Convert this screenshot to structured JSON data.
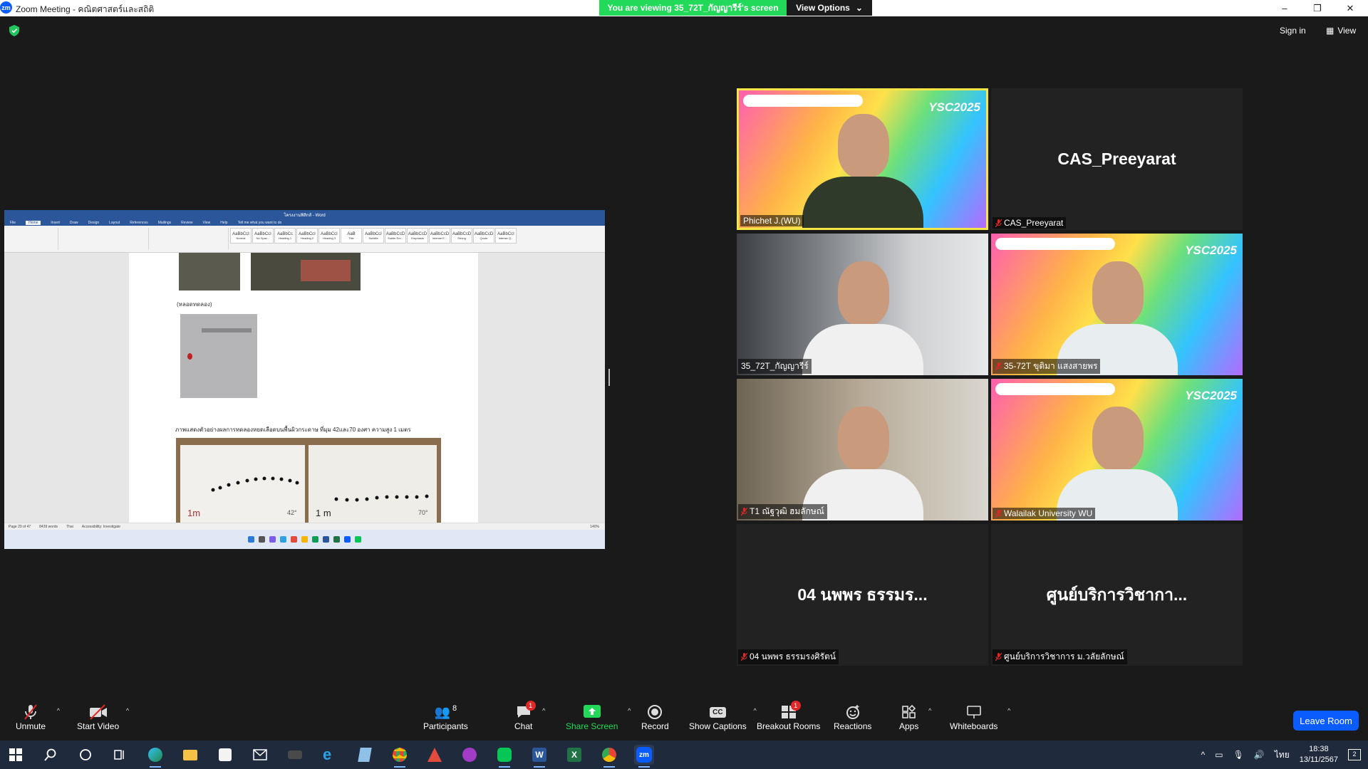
{
  "window": {
    "title": "Zoom Meeting - คณิตศาสตร์และสถิติ",
    "minimize": "–",
    "maximize": "❐",
    "close": "✕"
  },
  "banner": {
    "text": "You are viewing 35_72T_กัญญารีร์'s screen",
    "view_options": "View Options"
  },
  "topbar": {
    "sign_in": "Sign in",
    "view": "View"
  },
  "shared_screen": {
    "window_title": "โครงงานฟิสิกส์ - Word",
    "tabs": [
      "File",
      "Home",
      "Insert",
      "Draw",
      "Design",
      "Layout",
      "References",
      "Mailings",
      "Review",
      "View",
      "Help",
      "Tell me what you want to do"
    ],
    "active_tab": "Home",
    "styles": [
      "AaBbCcI",
      "AaBbCcI",
      "AaBbCc",
      "AaBbCcI",
      "AaBbCcI",
      "AaB",
      "AaBbCcI",
      "AaBbCcD",
      "AaBbCcD",
      "AaBbCcD",
      "AaBbCcD",
      "AaBbCcD",
      "AaBbCcI"
    ],
    "style_names": [
      "Normal",
      "No Spac...",
      "Heading 1",
      "Heading 2",
      "Heading 3",
      "Title",
      "Subtitle",
      "Subtle Em...",
      "Emphasis",
      "Intense E...",
      "Strong",
      "Quote",
      "Intense Q..."
    ],
    "caption1": "(หลอดทดลอง)",
    "caption2": "ภาพแสดงตัวอย่างผลการทดลองหยดเลือดบนพื้นผิวกระดาษ ที่มุม 42และ70 องศา ความสูง 1 เมตร",
    "photo_labels": [
      "1m",
      "42°",
      "1 m",
      "70°"
    ],
    "status": {
      "page": "Page 20 of 47",
      "words": "8439 words",
      "language": "Thai",
      "accessibility": "Accessibility: Investigate",
      "zoom": "140%"
    }
  },
  "participants_tiles": [
    {
      "name": "Phichet J.(WU)",
      "muted": false,
      "active_speaker": true,
      "video": true,
      "bg": "ysc"
    },
    {
      "name": "CAS_Preeyarat",
      "big_name": "CAS_Preeyarat",
      "muted": true,
      "video": false
    },
    {
      "name": "35_72T_กัญญารีร์",
      "muted": false,
      "video": true,
      "bg": "room"
    },
    {
      "name": "35-72T ขุติมา แสงสายพร",
      "muted": true,
      "video": true,
      "bg": "ysc"
    },
    {
      "name": "T1 ณัฐวุฒิ ฮมลักษณ์",
      "muted": true,
      "video": true,
      "bg": "room2"
    },
    {
      "name": "Walailak University WU",
      "muted": true,
      "video": true,
      "bg": "ysc"
    },
    {
      "name": "04 นพพร ธรรมรงศิรัตน์",
      "big_name": "04 นพพร ธรรมร...",
      "muted": true,
      "video": false
    },
    {
      "name": "ศูนย์บริการวิชาการ ม.วลัยลักษณ์",
      "big_name": "ศูนย์บริการวิชากา...",
      "muted": true,
      "video": false
    }
  ],
  "ysc_logo": "YSC2025",
  "toolbar": {
    "unmute": "Unmute",
    "start_video": "Start Video",
    "participants": "Participants",
    "participants_count": "8",
    "chat": "Chat",
    "chat_badge": "1",
    "share_screen": "Share Screen",
    "record": "Record",
    "show_captions": "Show Captions",
    "breakout_rooms": "Breakout Rooms",
    "breakout_badge": "1",
    "reactions": "Reactions",
    "apps": "Apps",
    "whiteboards": "Whiteboards",
    "leave_room": "Leave Room"
  },
  "taskbar": {
    "time": "18:38",
    "date": "13/11/2567",
    "language": "ไทย",
    "notifications": "2"
  },
  "colors": {
    "zoom_blue": "#0b5cff",
    "banner_green": "#23d959",
    "active_speaker": "#f5e547",
    "mute_red": "#e02828"
  }
}
